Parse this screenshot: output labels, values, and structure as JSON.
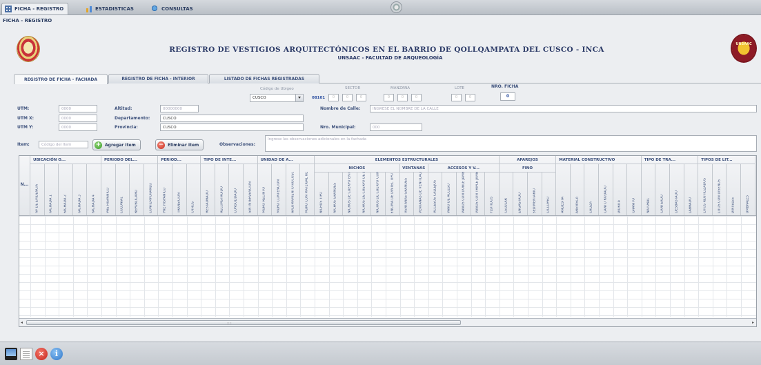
{
  "top_tabs": [
    {
      "label": "FICHA - REGISTRO",
      "icon": "grid-icon",
      "active": true
    },
    {
      "label": "ESTADISTICAS",
      "icon": "chart-icon",
      "active": false
    },
    {
      "label": "CONSULTAS",
      "icon": "query-icon",
      "active": false
    }
  ],
  "breadcrumb": "FICHA - REGISTRO",
  "header": {
    "title": "REGISTRO DE VESTIGIOS ARQUITECTÓNICOS EN EL BARRIO DE QOLLQAMPATA DEL CUSCO - INCA",
    "subtitle": "UNSAAC - FACULTAD DE ARQUEOLOGÍA",
    "right_logo_text": "UNSAAC"
  },
  "section_tabs": [
    {
      "label": "REGISTRO DE FICHA - FACHADA",
      "active": true
    },
    {
      "label": "REGISTRO DE FICHA - INTERIOR",
      "active": false
    },
    {
      "label": "LISTADO DE FICHAS REGISTRADAS",
      "active": false
    }
  ],
  "ubigeo": {
    "label": "Código de Ubigeo",
    "select_value": "CUSCO",
    "code": "08101",
    "sector_label": "SECTOR",
    "manzana_label": "MANZANA",
    "lote_label": "LOTE",
    "cells": [
      "0",
      "0",
      "0",
      "0",
      "0",
      "0",
      "0",
      "0"
    ],
    "nro_ficha_label": "NRO. FICHA",
    "nro_ficha_value": "0"
  },
  "form": {
    "utm_label": "UTM:",
    "utm_value": "0000",
    "utm_x_label": "UTM X:",
    "utm_x_value": "0000",
    "utm_y_label": "UTM Y:",
    "utm_y_value": "0000",
    "altitud_label": "Altitud:",
    "altitud_value": "00000000",
    "departamento_label": "Departamento:",
    "departamento_value": "CUSCO",
    "provincia_label": "Provincia:",
    "provincia_value": "CUSCO",
    "calle_label": "Nombre de Calle:",
    "calle_placeholder": "INGRESE EL NOMBRE DE LA CALLE",
    "municipal_label": "Nro. Municipal:",
    "municipal_value": "000",
    "item_label": "Item:",
    "item_placeholder": "Código del Item",
    "add_button": "Agregar Item",
    "remove_button": "Eliminar Item",
    "obs_label": "Observaciones:",
    "obs_placeholder": "Ingrese las observaciones adicionales en la fachada"
  },
  "table": {
    "row_header": "N...",
    "groups": [
      {
        "label": "UBICACIÓN O..."
      },
      {
        "label": "PERIODO DEL..."
      },
      {
        "label": "PERIOD..."
      },
      {
        "label": "TIPO DE INTE..."
      },
      {
        "label": "UNIDAD DE A..."
      },
      {
        "label": "ELEMENTOS ESTRUCTURALES"
      },
      {
        "label": "APAREJOS"
      },
      {
        "label": "MATERIAL CONSTRUCTIVO"
      },
      {
        "label": "TIPO DE TRA..."
      },
      {
        "label": "TIPOS DE LIT..."
      }
    ],
    "subgroups": [
      {
        "label": "NICHOS"
      },
      {
        "label": "VENTANAS"
      },
      {
        "label": "ACCESOS Y V..."
      },
      {
        "label": "FINO"
      }
    ],
    "columns": [
      "Nº DE EVIDENCIA",
      "FACHADA 1",
      "FACHADA 2",
      "FACHADA 3",
      "FACHADA 4",
      "PRE HISPANICO",
      "COLONIAL",
      "REPUBLICANO",
      "CONTEMPORANEO",
      "PRE HISPANICO",
      "TRANSICION",
      "OTROS",
      "RESTAURADO",
      "RECONSTRUIDO",
      "CONSOLIDADO",
      "SIN INTERVENCION",
      "MURO RECINTO",
      "MURO CONTENCION",
      "APLOMAMIENTO ROCOSO",
      "MURO CON MATERIAL REUTILIZADO",
      "NICHOS TIPO",
      "NICHOS GRANDES",
      "NICHOS DE CUERPO ENTERO",
      "NICHOS DE CUERPO DE DOBLE",
      "NICHOS DE CUERPO CON DESAGUE",
      "ENCIMA DE DINTEL TIPO",
      "VENTANAS GRANDES",
      "VENTANAS DE VENTILACION",
      "ACCESOS CALLEJOS",
      "VANO DE ACCESO",
      "VANOS CON DOBLE JAMBA",
      "VANOS CON TRIPLE JAMBA",
      "FLOTIDOS",
      "CELULAR",
      "ENGASTADO",
      "SEDIMENTARIO",
      "CICLOPEO",
      "ANDESITA",
      "ARENISCA",
      "CALIZA",
      "CANTO RODADO",
      "DIORITA",
      "GRANITO",
      "NATURAL",
      "CANTEADO",
      "DESBASTADO",
      "LABRADO",
      "LITOS REUTILIZADOS",
      "LITOS CON DISEÑOS",
      "DINTELES",
      "UMBRALES"
    ],
    "scroll_grip": "::::"
  },
  "bottom_bar": [
    "monitor-icon",
    "clipboard-icon",
    "close-icon",
    "info-icon"
  ]
}
